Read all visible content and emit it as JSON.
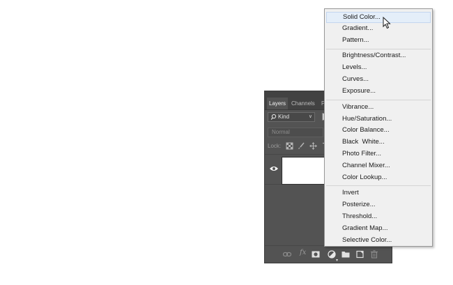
{
  "layers_panel": {
    "tabs": [
      {
        "label": "Layers",
        "active": true
      },
      {
        "label": "Channels",
        "active": false
      },
      {
        "label": "P",
        "active": false
      }
    ],
    "filter": {
      "kind_label": "Kind",
      "icon": "search-icon"
    },
    "blend_mode": "Normal",
    "lock_label": "Lock:",
    "lock_icons": [
      "lock-transparent-icon",
      "lock-paint-brush-icon",
      "lock-move-icon",
      "lock-artboard-icon"
    ],
    "layer": {
      "visible": true,
      "thumbnail_color": "#ffffff"
    },
    "bottom_icons": [
      "link-icon",
      "fx-icon",
      "mask-icon",
      "adjustment-layer-icon",
      "group-folder-icon",
      "new-layer-icon",
      "trash-icon"
    ],
    "fx_label": "fx"
  },
  "menu": {
    "groups": [
      [
        "Solid Color...",
        "Gradient...",
        "Pattern..."
      ],
      [
        "Brightness/Contrast...",
        "Levels...",
        "Curves...",
        "Exposure..."
      ],
      [
        "Vibrance...",
        "Hue/Saturation...",
        "Color Balance...",
        "Black  White...",
        "Photo Filter...",
        "Channel Mixer...",
        "Color Lookup..."
      ],
      [
        "Invert",
        "Posterize...",
        "Threshold...",
        "Gradient Map...",
        "Selective Color..."
      ]
    ],
    "highlighted": "Solid Color..."
  },
  "colors": {
    "panel_bg": "#535353",
    "menu_bg": "#f0f0f0",
    "menu_highlight": "#e4eef9"
  }
}
